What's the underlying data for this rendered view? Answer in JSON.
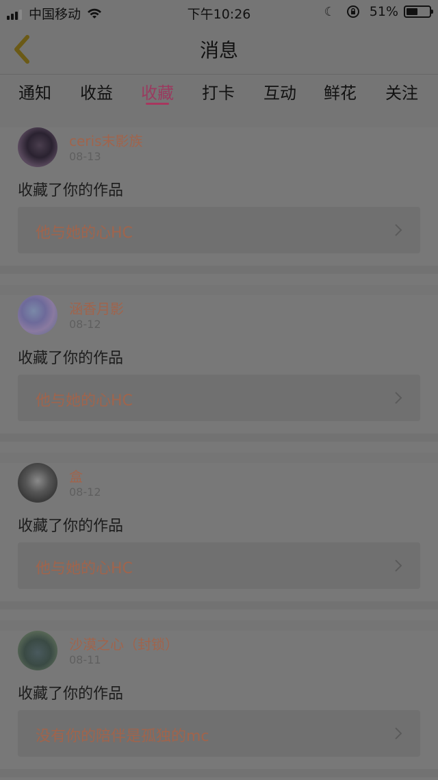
{
  "status": {
    "carrier": "中国移动",
    "time": "下午10:26",
    "battery": "51%",
    "battery_level": 0.51
  },
  "nav": {
    "title": "消息"
  },
  "tabs": [
    {
      "label": "通知"
    },
    {
      "label": "收益"
    },
    {
      "label": "收藏",
      "active": true
    },
    {
      "label": "打卡"
    },
    {
      "label": "互动"
    },
    {
      "label": "鲜花"
    },
    {
      "label": "关注"
    }
  ],
  "items": [
    {
      "user": "ceris末影族",
      "date": "08-13",
      "action": "收藏了你的作品",
      "work": "他与她的心HC"
    },
    {
      "user": "涵香月影",
      "date": "08-12",
      "action": "收藏了你的作品",
      "work": "他与她的心HC"
    },
    {
      "user": "盒",
      "date": "08-12",
      "action": "收藏了你的作品",
      "work": "他与她的心HC"
    },
    {
      "user": "沙漠之心（封锁）",
      "date": "08-11",
      "action": "收藏了你的作品",
      "work": "没有你的陪伴是孤独的mc"
    }
  ],
  "colors": {
    "accent": "#a8365e",
    "link": "#a0644c"
  }
}
